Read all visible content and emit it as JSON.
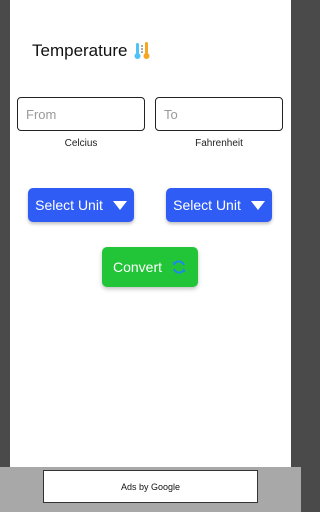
{
  "header": {
    "title": "Temperature",
    "icon": "thermometer-icon"
  },
  "inputs": {
    "from_placeholder": "From",
    "to_placeholder": "To",
    "from_value": "",
    "to_value": ""
  },
  "units": {
    "from_label": "Celcius",
    "to_label": "Fahrenheit"
  },
  "selectors": {
    "from_label": "Select Unit",
    "to_label": "Select Unit"
  },
  "actions": {
    "convert_label": "Convert",
    "convert_icon": "refresh-icon"
  },
  "ads": {
    "label": "Ads by Google"
  },
  "colors": {
    "select_button": "#2f5cf5",
    "convert_button": "#22c538",
    "ad_bar": "#a8a8a8"
  }
}
